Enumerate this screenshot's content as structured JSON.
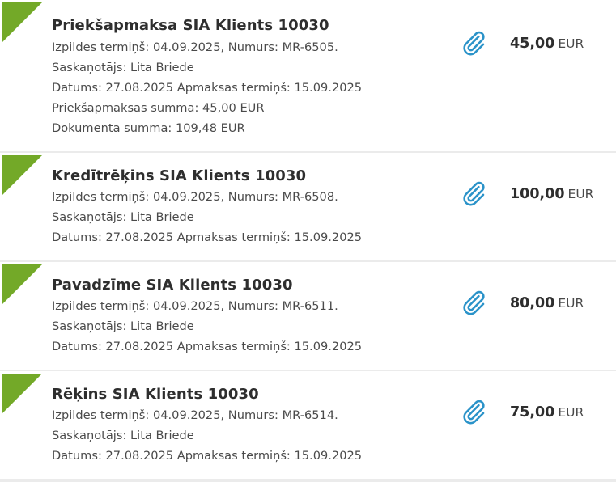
{
  "documents": [
    {
      "title": "Priekšapmaksa SIA Klients 10030",
      "lines": [
        "Izpildes termiņš: 04.09.2025, Numurs: MR-6505.",
        "Saskaņotājs: Lita Briede",
        "Datums: 27.08.2025 Apmaksas termiņš: 15.09.2025",
        "Priekšapmaksas summa: 45,00 EUR",
        "Dokumenta summa: 109,48 EUR"
      ],
      "amount": "45,00",
      "currency": "EUR",
      "attachment_icon": "paperclip-icon"
    },
    {
      "title": "Kredītrēķins SIA Klients 10030",
      "lines": [
        "Izpildes termiņš: 04.09.2025, Numurs: MR-6508.",
        "Saskaņotājs: Lita Briede",
        "Datums: 27.08.2025 Apmaksas termiņš: 15.09.2025"
      ],
      "amount": "100,00",
      "currency": "EUR",
      "attachment_icon": "paperclip-icon"
    },
    {
      "title": "Pavadzīme SIA Klients 10030",
      "lines": [
        "Izpildes termiņš: 04.09.2025, Numurs: MR-6511.",
        "Saskaņotājs: Lita Briede",
        "Datums: 27.08.2025 Apmaksas termiņš: 15.09.2025"
      ],
      "amount": "80,00",
      "currency": "EUR",
      "attachment_icon": "paperclip-icon"
    },
    {
      "title": "Rēķins SIA Klients 10030",
      "lines": [
        "Izpildes termiņš: 04.09.2025, Numurs: MR-6514.",
        "Saskaņotājs: Lita Briede",
        "Datums: 27.08.2025 Apmaksas termiņš: 15.09.2025"
      ],
      "amount": "75,00",
      "currency": "EUR",
      "attachment_icon": "paperclip-icon"
    }
  ],
  "colors": {
    "corner_marker": "#73a928",
    "attachment_icon": "#2b93c9"
  }
}
